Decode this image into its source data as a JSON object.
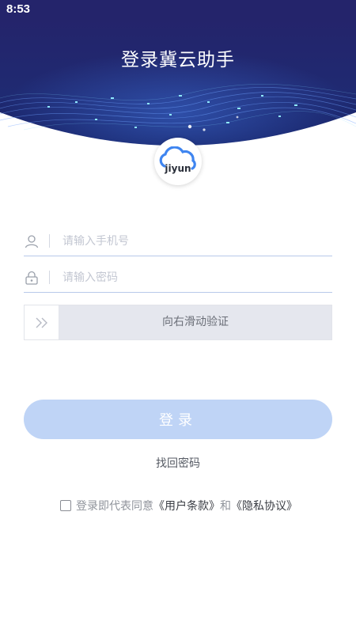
{
  "status_bar": {
    "time": "8:53"
  },
  "header": {
    "title": "登录冀云助手"
  },
  "logo": {
    "text": "jiyun"
  },
  "form": {
    "phone_placeholder": "请输入手机号",
    "password_placeholder": "请输入密码",
    "slider_label": "向右滑动验证",
    "login_label": "登录"
  },
  "forgot_password": "找回密码",
  "agreement": {
    "prefix": "登录即代表同意",
    "user_terms": "《用户条款》",
    "joiner": "和",
    "privacy": "《隐私协议》",
    "checked": false
  },
  "colors": {
    "header_bg": "#24246b",
    "accent": "#3f85f0",
    "login_button": "#bfd4f6"
  }
}
